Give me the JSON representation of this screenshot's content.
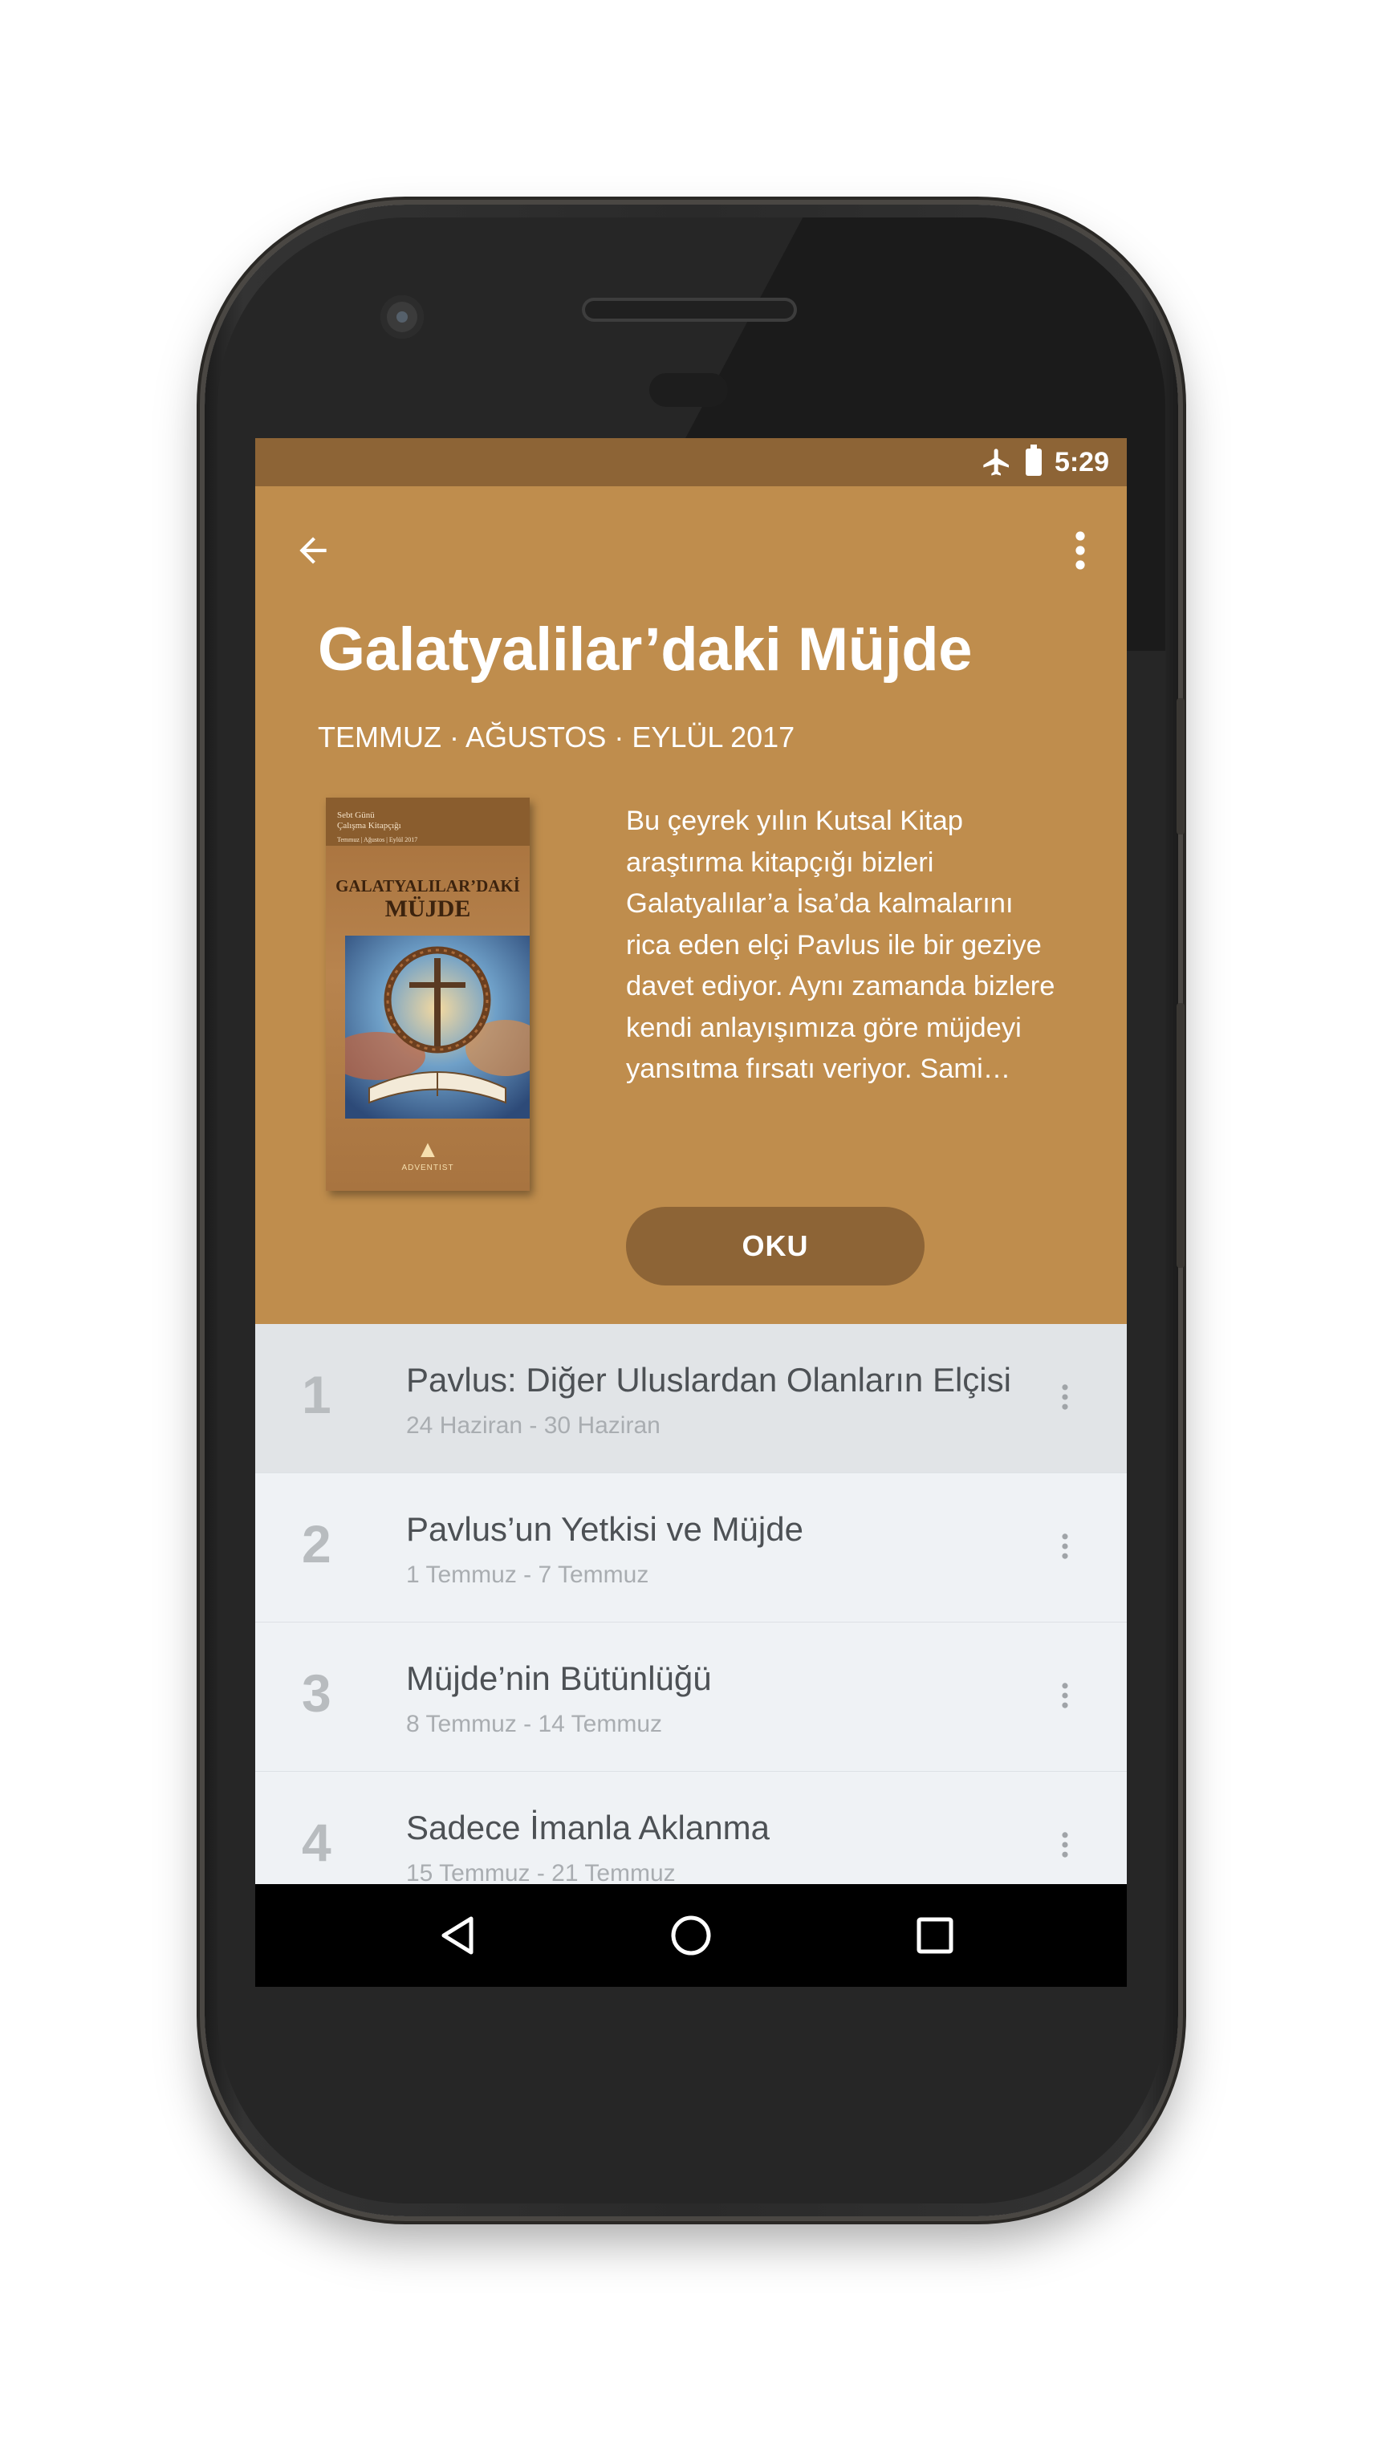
{
  "status_bar": {
    "time": "5:29",
    "icons": [
      "airplane-icon",
      "battery-icon"
    ]
  },
  "header": {
    "back_icon": "arrow-back-icon",
    "menu_icon": "more-vert-icon",
    "title": "Galatyalilar’daki Müjde",
    "quarter": "TEMMUZ · AĞUSTOS · EYLÜL 2017",
    "description": "Bu çeyrek yılın Kutsal Kitap araştırma kitapçığı bizleri Galatyalılar’a İsa’da kalmalarını rica eden elçi Pavlus ile bir geziye davet ediyor. Aynı zamanda bizlere kendi anlayışımıza göre müjdeyi yansıtma fırsatı veriyor. Sami…",
    "read_button": "OKU",
    "colors": {
      "status_bar": "#8d6436",
      "header_bg": "#bf8d4d",
      "button_bg": "#8d6436"
    }
  },
  "cover": {
    "small_text_line1": "Sebt Günü",
    "small_text_line2": "Çalışma Kitapçığı",
    "small_text_line3": "Temmuz | Ağustos | Eylül 2017",
    "title_line1": "GALATYALILAR’DAKİ",
    "title_line2": "MÜJDE",
    "publisher": "ADVENTIST"
  },
  "lessons": [
    {
      "number": "1",
      "title": "Pavlus: Diğer Uluslardan Olanların Elçisi",
      "dates": "24 Haziran - 30 Haziran",
      "active": true
    },
    {
      "number": "2",
      "title": "Pavlus’un Yetkisi ve Müjde",
      "dates": "1 Temmuz - 7 Temmuz",
      "active": false
    },
    {
      "number": "3",
      "title": "Müjde’nin Bütünlüğü",
      "dates": "8 Temmuz - 14 Temmuz",
      "active": false
    },
    {
      "number": "4",
      "title": "Sadece İmanla Aklanma",
      "dates": "15 Temmuz - 21 Temmuz",
      "active": false
    }
  ],
  "nav_bar": {
    "icons": [
      "back-triangle-icon",
      "home-circle-icon",
      "recents-square-icon"
    ]
  }
}
